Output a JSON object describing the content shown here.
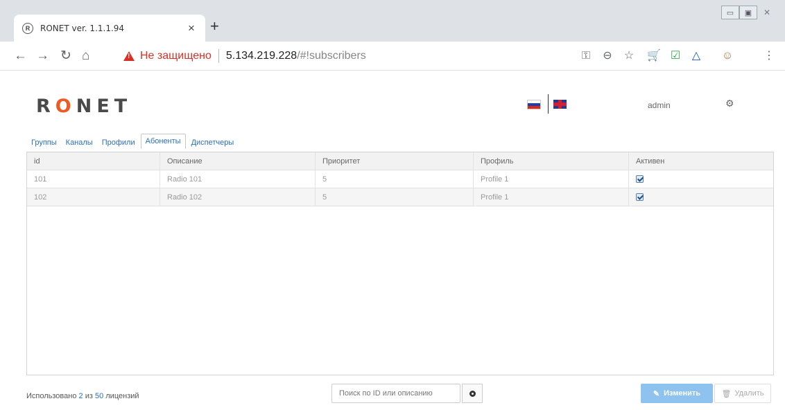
{
  "browser": {
    "tab_title": "RONET ver. 1.1.1.94",
    "tab_icon": "ronet-favicon",
    "tab_favicon_letter": "R",
    "insecure_label": "Не защищено",
    "url_host": "5.134.219.228",
    "url_path": "/#!subscribers"
  },
  "app": {
    "logo": {
      "left": "R",
      "o": "O",
      "right": "NET"
    },
    "user": "admin",
    "tabs": [
      "Группы",
      "Каналы",
      "Профили",
      "Абоненты",
      "Диспетчеры"
    ],
    "active_tab": "Абоненты",
    "table": {
      "headers": [
        "id",
        "Описание",
        "Приоритет",
        "Профиль",
        "Активен"
      ],
      "rows": [
        {
          "id": "101",
          "description": "Radio 101",
          "priority": "5",
          "profile": "Profile 1",
          "active": true
        },
        {
          "id": "102",
          "description": "Radio 102",
          "priority": "5",
          "profile": "Profile 1",
          "active": true
        }
      ]
    },
    "footer": {
      "license_prefix": "Использовано ",
      "used": "2",
      "license_mid": " из ",
      "total": "50",
      "license_suffix": " лицензий",
      "search_placeholder": "Поиск по ID или описанию",
      "edit_label": "Изменить",
      "delete_label": "Удалить"
    },
    "colors": {
      "accent": "#2a6ebb",
      "logo_o": "#ef5a24",
      "edit_button": "#8ec2ef",
      "insecure": "#d93025"
    }
  }
}
